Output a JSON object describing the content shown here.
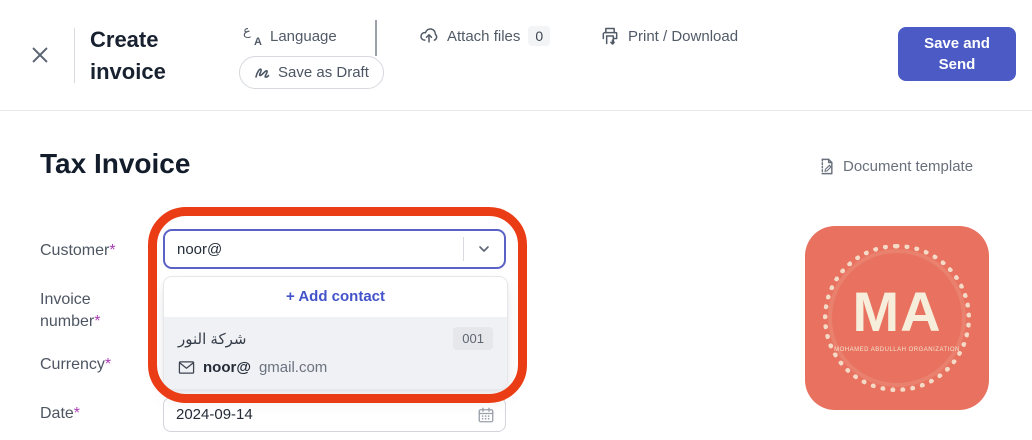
{
  "header": {
    "title": "Create invoice",
    "language_label": "Language",
    "language_icon_main": "ع",
    "language_icon_sub": "A",
    "save_as_draft_label": "Save as Draft",
    "attach_files_label": "Attach files",
    "attach_files_count": "0",
    "print_download_label": "Print / Download",
    "save_and_send_label": "Save and Send"
  },
  "main": {
    "page_title": "Tax Invoice",
    "document_template_label": "Document template"
  },
  "form": {
    "customer_label": "Customer",
    "invoice_number_label": "Invoice number",
    "currency_label": "Currency",
    "date_label": "Date",
    "required_mark": "*",
    "customer_input_value": "noor@",
    "date_value": "2024-09-14"
  },
  "dropdown": {
    "add_contact_label": "+ Add contact",
    "contact": {
      "name": "شركة النور",
      "code": "001",
      "email_user": "noor@",
      "email_domain": "gmail.com"
    }
  },
  "logo": {
    "initials": "MA",
    "subtext": "MOHAMED ABDULLAH ORGANIZATION"
  },
  "colors": {
    "accent_button": "#4b5ac4",
    "annotation_red": "#eb3d15",
    "focus_border": "#5a62c6",
    "link_indigo": "#4353c9",
    "required_purple": "#ab3db4",
    "logo_coral": "#e8725f"
  }
}
